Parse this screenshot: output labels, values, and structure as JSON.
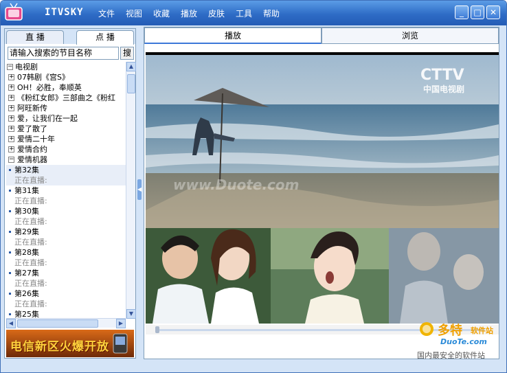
{
  "window": {
    "app_name": "ITVSKY",
    "menu": [
      "文件",
      "视图",
      "收藏",
      "播放",
      "皮肤",
      "工具",
      "帮助"
    ],
    "controls": {
      "minimize": "_",
      "maximize": "□",
      "close": "✕"
    }
  },
  "left_panel": {
    "tabs": [
      "直 播",
      "点 播"
    ],
    "active_tab": 1,
    "search": {
      "value": "请输入搜索的节目名称",
      "button": "搜"
    },
    "tree": {
      "root": "电视剧",
      "items": [
        {
          "label": "07韩剧《宫S》",
          "expanded": false
        },
        {
          "label": "OH！必胜，奉顺英",
          "expanded": false
        },
        {
          "label": "《粉红女郎》三部曲之《粉红",
          "expanded": false
        },
        {
          "label": "阿旺新传",
          "expanded": false
        },
        {
          "label": "爱，让我们在一起",
          "expanded": false
        },
        {
          "label": "爱了散了",
          "expanded": false
        },
        {
          "label": "爱情二十年",
          "expanded": false
        },
        {
          "label": "爱情合约",
          "expanded": false
        },
        {
          "label": "爱情机器",
          "expanded": true
        }
      ],
      "episodes": [
        {
          "label": "第32集",
          "status": "正在直播:"
        },
        {
          "label": "第31集",
          "status": "正在直播:"
        },
        {
          "label": "第30集",
          "status": "正在直播:"
        },
        {
          "label": "第29集",
          "status": "正在直播:"
        },
        {
          "label": "第28集",
          "status": "正在直播:"
        },
        {
          "label": "第27集",
          "status": "正在直播:"
        },
        {
          "label": "第26集",
          "status": "正在直播:"
        },
        {
          "label": "第25集",
          "status": ""
        }
      ]
    },
    "banner_text": "电信新区火爆开放"
  },
  "right_panel": {
    "tabs": [
      "播放",
      "浏览"
    ],
    "active_tab": 0,
    "video": {
      "channel_logo_line1": "CTTV",
      "channel_logo_line2": "中国电视剧",
      "watermark": "www.Duote.com"
    }
  },
  "site_watermark": {
    "brand": "多特",
    "brand_suffix": "软件站",
    "domain": "DuoTe.com",
    "slogan": "国内最安全的软件站"
  }
}
